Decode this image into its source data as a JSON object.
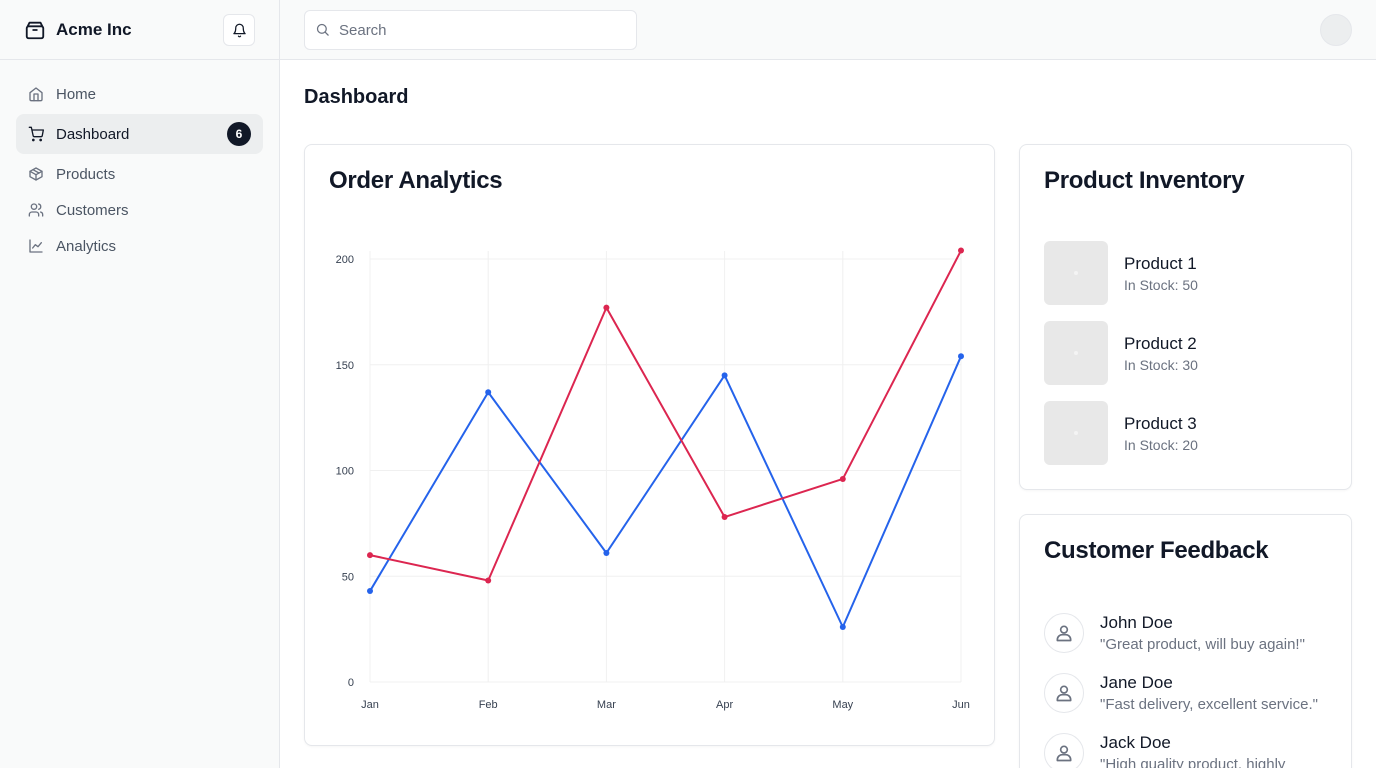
{
  "brand": {
    "name": "Acme Inc",
    "logo_icon": "package-icon"
  },
  "sidebar": {
    "items": [
      {
        "label": "Home",
        "icon": "home-icon"
      },
      {
        "label": "Dashboard",
        "icon": "cart-icon",
        "badge": "6",
        "active": true
      },
      {
        "label": "Products",
        "icon": "box-icon"
      },
      {
        "label": "Customers",
        "icon": "users-icon"
      },
      {
        "label": "Analytics",
        "icon": "line-chart-icon"
      }
    ]
  },
  "topbar": {
    "search_placeholder": "Search"
  },
  "page": {
    "title": "Dashboard"
  },
  "order_analytics": {
    "title": "Order Analytics",
    "chart_data": {
      "type": "line",
      "categories": [
        "Jan",
        "Feb",
        "Mar",
        "Apr",
        "May",
        "Jun"
      ],
      "series": [
        {
          "values": [
            43,
            137,
            61,
            145,
            26,
            154
          ],
          "color": "#2563eb"
        },
        {
          "values": [
            60,
            48,
            177,
            78,
            96,
            204
          ],
          "color": "#dc2650"
        }
      ],
      "yticks": [
        "0",
        "50",
        "100",
        "150",
        "200"
      ],
      "ylim": [
        0,
        200
      ],
      "grid": true
    }
  },
  "inventory": {
    "title": "Product Inventory",
    "products": [
      {
        "name": "Product 1",
        "stock": "In Stock: 50"
      },
      {
        "name": "Product 2",
        "stock": "In Stock: 30"
      },
      {
        "name": "Product 3",
        "stock": "In Stock: 20"
      }
    ]
  },
  "feedback": {
    "title": "Customer Feedback",
    "items": [
      {
        "name": "John Doe",
        "quote": "\"Great product, will buy again!\""
      },
      {
        "name": "Jane Doe",
        "quote": "\"Fast delivery, excellent service.\""
      },
      {
        "name": "Jack Doe",
        "quote": "\"High quality product, highly"
      }
    ]
  },
  "colors": {
    "accent": "#111827",
    "series_blue": "#2563eb",
    "series_red": "#dc2650"
  }
}
